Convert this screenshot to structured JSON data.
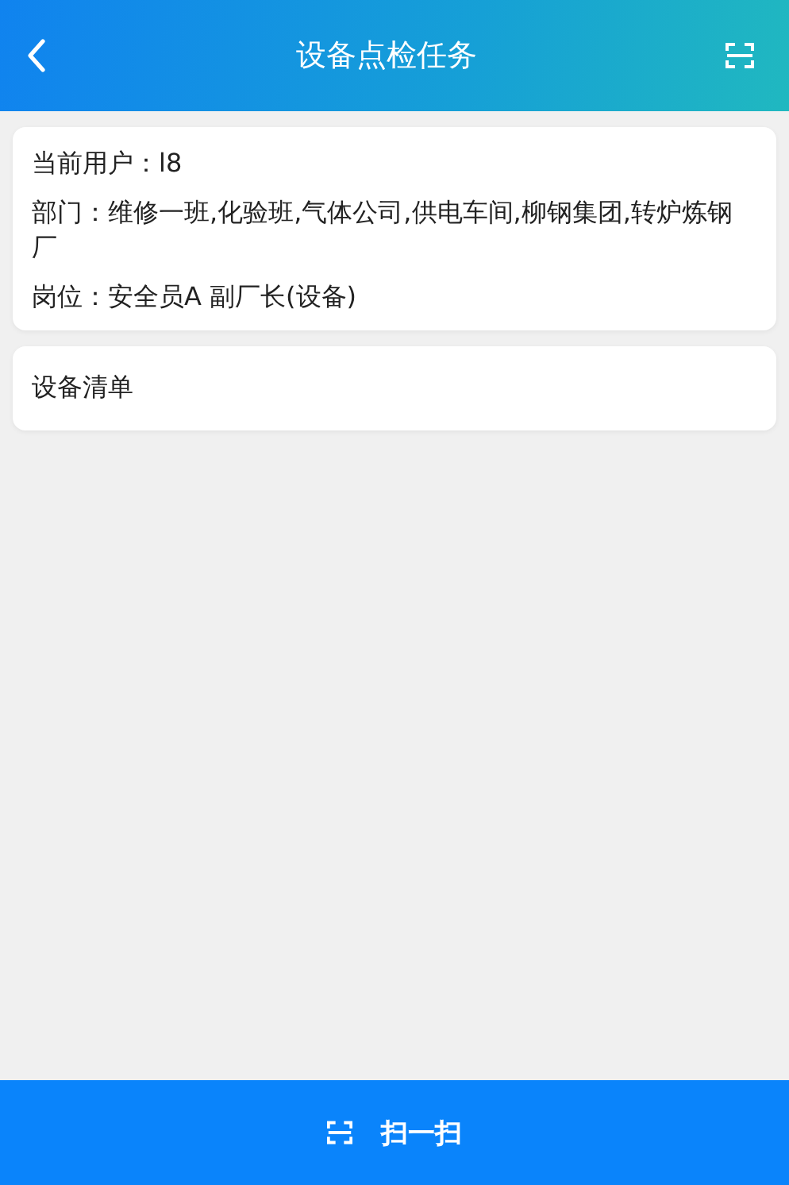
{
  "header": {
    "title": "设备点检任务"
  },
  "info_card": {
    "lines": [
      "当前用户：l8",
      "部门：维修一班,化验班,气体公司,供电车间,柳钢集团,转炉炼钢厂",
      "岗位：安全员A 副厂长(设备)"
    ]
  },
  "list_card": {
    "title": "设备清单"
  },
  "bottom_button": {
    "label": "扫一扫"
  }
}
